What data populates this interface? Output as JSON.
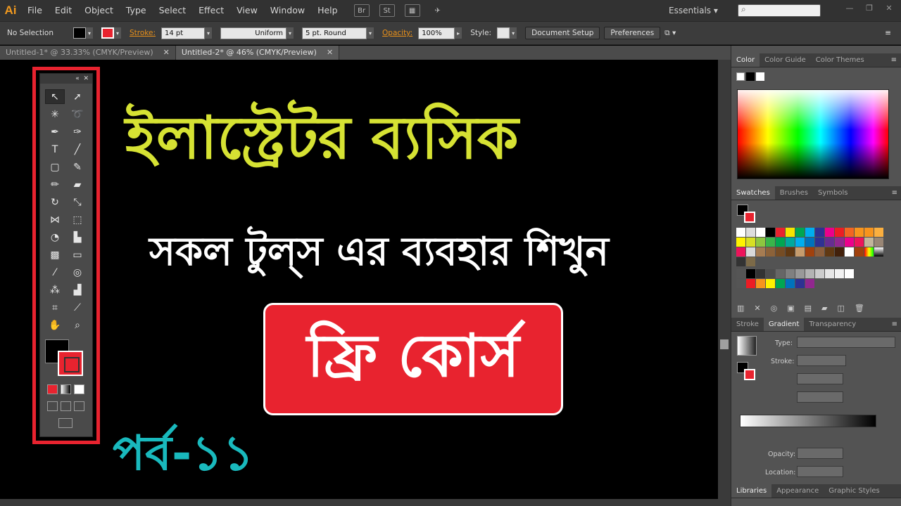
{
  "app": {
    "logo": "Ai"
  },
  "menu": [
    "File",
    "Edit",
    "Object",
    "Type",
    "Select",
    "Effect",
    "View",
    "Window",
    "Help"
  ],
  "workspace": "Essentials",
  "control_bar": {
    "selection": "No Selection",
    "stroke_label": "Stroke:",
    "stroke_weight": "14 pt",
    "profile": "Uniform",
    "brush": "5 pt. Round",
    "opacity_label": "Opacity:",
    "opacity": "100%",
    "style_label": "Style:",
    "document_setup": "Document Setup",
    "preferences": "Preferences"
  },
  "tabs": [
    {
      "label": "Untitled-1* @ 33.33% (CMYK/Preview)"
    },
    {
      "label": "Untitled-2* @ 46% (CMYK/Preview)"
    }
  ],
  "artwork": {
    "title": "ইলাস্ট্রেটর ব্যসিক",
    "subtitle": "সকল টুল্স এর ব্যবহার শিখুন",
    "badge": "ফ্রি কোর্স",
    "episode": "পর্ব-১১"
  },
  "colors": {
    "title": "#d6e233",
    "badge_bg": "#e8232f",
    "episode": "#19b9bd",
    "highlight_frame": "#e8232f"
  },
  "panels": {
    "color_tabs": [
      "Color",
      "Color Guide",
      "Color Themes"
    ],
    "swatch_tabs": [
      "Swatches",
      "Brushes",
      "Symbols"
    ],
    "stroke_tabs": [
      "Stroke",
      "Gradient",
      "Transparency"
    ],
    "gradient": {
      "type_label": "Type:",
      "stroke_label": "Stroke:",
      "opacity_label": "Opacity:",
      "location_label": "Location:"
    },
    "bottom_tabs": [
      "Libraries",
      "Appearance",
      "Graphic Styles"
    ]
  }
}
